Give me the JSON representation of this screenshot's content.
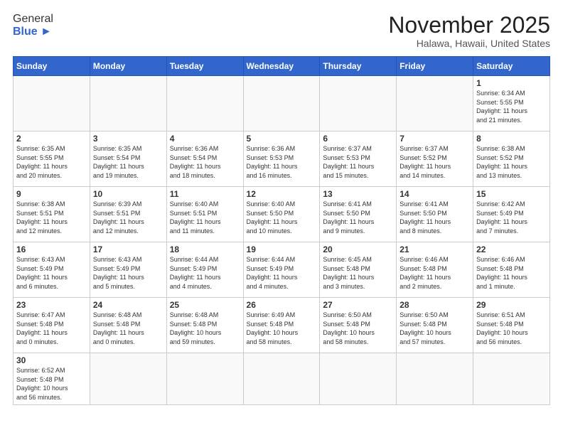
{
  "header": {
    "logo_text_normal": "General",
    "logo_text_bold": "Blue",
    "month_title": "November 2025",
    "location": "Halawa, Hawaii, United States"
  },
  "days_of_week": [
    "Sunday",
    "Monday",
    "Tuesday",
    "Wednesday",
    "Thursday",
    "Friday",
    "Saturday"
  ],
  "weeks": [
    [
      {
        "day": "",
        "info": ""
      },
      {
        "day": "",
        "info": ""
      },
      {
        "day": "",
        "info": ""
      },
      {
        "day": "",
        "info": ""
      },
      {
        "day": "",
        "info": ""
      },
      {
        "day": "",
        "info": ""
      },
      {
        "day": "1",
        "info": "Sunrise: 6:34 AM\nSunset: 5:55 PM\nDaylight: 11 hours\nand 21 minutes."
      }
    ],
    [
      {
        "day": "2",
        "info": "Sunrise: 6:35 AM\nSunset: 5:55 PM\nDaylight: 11 hours\nand 20 minutes."
      },
      {
        "day": "3",
        "info": "Sunrise: 6:35 AM\nSunset: 5:54 PM\nDaylight: 11 hours\nand 19 minutes."
      },
      {
        "day": "4",
        "info": "Sunrise: 6:36 AM\nSunset: 5:54 PM\nDaylight: 11 hours\nand 18 minutes."
      },
      {
        "day": "5",
        "info": "Sunrise: 6:36 AM\nSunset: 5:53 PM\nDaylight: 11 hours\nand 16 minutes."
      },
      {
        "day": "6",
        "info": "Sunrise: 6:37 AM\nSunset: 5:53 PM\nDaylight: 11 hours\nand 15 minutes."
      },
      {
        "day": "7",
        "info": "Sunrise: 6:37 AM\nSunset: 5:52 PM\nDaylight: 11 hours\nand 14 minutes."
      },
      {
        "day": "8",
        "info": "Sunrise: 6:38 AM\nSunset: 5:52 PM\nDaylight: 11 hours\nand 13 minutes."
      }
    ],
    [
      {
        "day": "9",
        "info": "Sunrise: 6:38 AM\nSunset: 5:51 PM\nDaylight: 11 hours\nand 12 minutes."
      },
      {
        "day": "10",
        "info": "Sunrise: 6:39 AM\nSunset: 5:51 PM\nDaylight: 11 hours\nand 12 minutes."
      },
      {
        "day": "11",
        "info": "Sunrise: 6:40 AM\nSunset: 5:51 PM\nDaylight: 11 hours\nand 11 minutes."
      },
      {
        "day": "12",
        "info": "Sunrise: 6:40 AM\nSunset: 5:50 PM\nDaylight: 11 hours\nand 10 minutes."
      },
      {
        "day": "13",
        "info": "Sunrise: 6:41 AM\nSunset: 5:50 PM\nDaylight: 11 hours\nand 9 minutes."
      },
      {
        "day": "14",
        "info": "Sunrise: 6:41 AM\nSunset: 5:50 PM\nDaylight: 11 hours\nand 8 minutes."
      },
      {
        "day": "15",
        "info": "Sunrise: 6:42 AM\nSunset: 5:49 PM\nDaylight: 11 hours\nand 7 minutes."
      }
    ],
    [
      {
        "day": "16",
        "info": "Sunrise: 6:43 AM\nSunset: 5:49 PM\nDaylight: 11 hours\nand 6 minutes."
      },
      {
        "day": "17",
        "info": "Sunrise: 6:43 AM\nSunset: 5:49 PM\nDaylight: 11 hours\nand 5 minutes."
      },
      {
        "day": "18",
        "info": "Sunrise: 6:44 AM\nSunset: 5:49 PM\nDaylight: 11 hours\nand 4 minutes."
      },
      {
        "day": "19",
        "info": "Sunrise: 6:44 AM\nSunset: 5:49 PM\nDaylight: 11 hours\nand 4 minutes."
      },
      {
        "day": "20",
        "info": "Sunrise: 6:45 AM\nSunset: 5:48 PM\nDaylight: 11 hours\nand 3 minutes."
      },
      {
        "day": "21",
        "info": "Sunrise: 6:46 AM\nSunset: 5:48 PM\nDaylight: 11 hours\nand 2 minutes."
      },
      {
        "day": "22",
        "info": "Sunrise: 6:46 AM\nSunset: 5:48 PM\nDaylight: 11 hours\nand 1 minute."
      }
    ],
    [
      {
        "day": "23",
        "info": "Sunrise: 6:47 AM\nSunset: 5:48 PM\nDaylight: 11 hours\nand 0 minutes."
      },
      {
        "day": "24",
        "info": "Sunrise: 6:48 AM\nSunset: 5:48 PM\nDaylight: 11 hours\nand 0 minutes."
      },
      {
        "day": "25",
        "info": "Sunrise: 6:48 AM\nSunset: 5:48 PM\nDaylight: 10 hours\nand 59 minutes."
      },
      {
        "day": "26",
        "info": "Sunrise: 6:49 AM\nSunset: 5:48 PM\nDaylight: 10 hours\nand 58 minutes."
      },
      {
        "day": "27",
        "info": "Sunrise: 6:50 AM\nSunset: 5:48 PM\nDaylight: 10 hours\nand 58 minutes."
      },
      {
        "day": "28",
        "info": "Sunrise: 6:50 AM\nSunset: 5:48 PM\nDaylight: 10 hours\nand 57 minutes."
      },
      {
        "day": "29",
        "info": "Sunrise: 6:51 AM\nSunset: 5:48 PM\nDaylight: 10 hours\nand 56 minutes."
      }
    ],
    [
      {
        "day": "30",
        "info": "Sunrise: 6:52 AM\nSunset: 5:48 PM\nDaylight: 10 hours\nand 56 minutes."
      },
      {
        "day": "",
        "info": ""
      },
      {
        "day": "",
        "info": ""
      },
      {
        "day": "",
        "info": ""
      },
      {
        "day": "",
        "info": ""
      },
      {
        "day": "",
        "info": ""
      },
      {
        "day": "",
        "info": ""
      }
    ]
  ]
}
